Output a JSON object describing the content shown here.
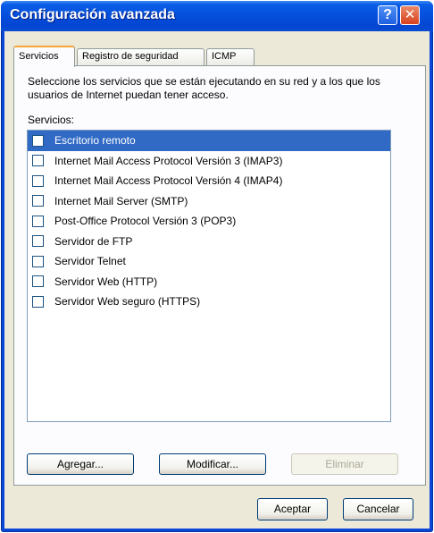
{
  "window": {
    "title": "Configuración avanzada",
    "help_label": "?",
    "close_label": "✕"
  },
  "tabs": [
    {
      "label": "Servicios",
      "active": true
    },
    {
      "label": "Registro de seguridad",
      "active": false
    },
    {
      "label": "ICMP",
      "active": false
    }
  ],
  "panel": {
    "description": "Seleccione los servicios que se están ejecutando en su red y a los que los usuarios de Internet puedan tener acceso.",
    "services_label": "Servicios:"
  },
  "services": [
    {
      "label": "Escritorio remoto",
      "checked": false,
      "selected": true
    },
    {
      "label": "Internet Mail Access Protocol Versión 3 (IMAP3)",
      "checked": false,
      "selected": false
    },
    {
      "label": "Internet Mail Access Protocol Versión 4 (IMAP4)",
      "checked": false,
      "selected": false
    },
    {
      "label": "Internet Mail Server (SMTP)",
      "checked": false,
      "selected": false
    },
    {
      "label": "Post-Office Protocol Versión 3 (POP3)",
      "checked": false,
      "selected": false
    },
    {
      "label": "Servidor de FTP",
      "checked": false,
      "selected": false
    },
    {
      "label": "Servidor Telnet",
      "checked": false,
      "selected": false
    },
    {
      "label": "Servidor Web (HTTP)",
      "checked": false,
      "selected": false
    },
    {
      "label": "Servidor Web seguro (HTTPS)",
      "checked": false,
      "selected": false
    }
  ],
  "buttons": {
    "agregar": "Agregar...",
    "modificar": "Modificar...",
    "eliminar": "Eliminar",
    "aceptar": "Aceptar",
    "cancelar": "Cancelar"
  },
  "colors": {
    "titlebar": "#0550de",
    "selection": "#316ac5",
    "dialog_bg": "#ece9d8",
    "active_tab_accent": "#f7a536"
  }
}
